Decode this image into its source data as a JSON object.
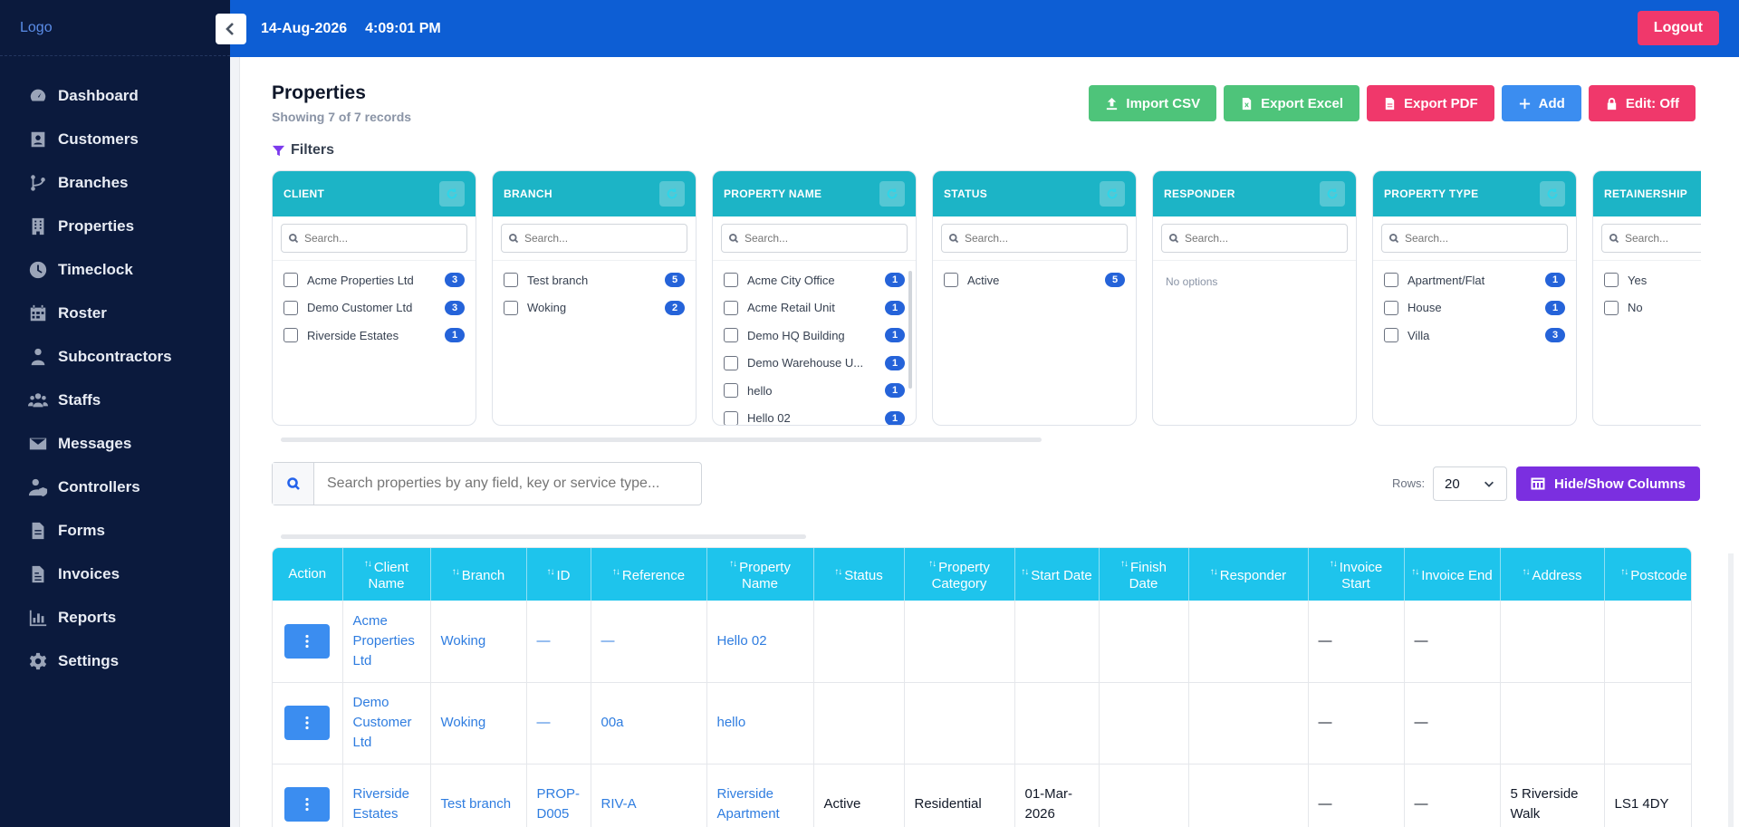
{
  "app": {
    "logo": "Logo"
  },
  "topbar": {
    "date": "14-Aug-2026",
    "time": "4:09:01 PM",
    "logout_label": "Logout"
  },
  "sidebar": {
    "items": [
      {
        "label": "Dashboard",
        "icon": "dashboard-icon"
      },
      {
        "label": "Customers",
        "icon": "customers-icon"
      },
      {
        "label": "Branches",
        "icon": "branches-icon"
      },
      {
        "label": "Properties",
        "icon": "properties-icon"
      },
      {
        "label": "Timeclock",
        "icon": "timeclock-icon"
      },
      {
        "label": "Roster",
        "icon": "roster-icon"
      },
      {
        "label": "Subcontractors",
        "icon": "subcontractors-icon"
      },
      {
        "label": "Staffs",
        "icon": "staffs-icon"
      },
      {
        "label": "Messages",
        "icon": "messages-icon"
      },
      {
        "label": "Controllers",
        "icon": "controllers-icon"
      },
      {
        "label": "Forms",
        "icon": "forms-icon"
      },
      {
        "label": "Invoices",
        "icon": "invoices-icon"
      },
      {
        "label": "Reports",
        "icon": "reports-icon"
      },
      {
        "label": "Settings",
        "icon": "settings-icon"
      }
    ]
  },
  "page": {
    "title": "Properties",
    "record_count": "Showing 7 of 7 records",
    "filters_label": "Filters"
  },
  "actions": {
    "import_csv": "Import CSV",
    "export_excel": "Export Excel",
    "export_pdf": "Export PDF",
    "add": "Add",
    "edit": "Edit: Off"
  },
  "colors": {
    "sidebar_bg": "#0b1a3d",
    "topbar_bg": "#0d5ed4",
    "filter_header": "#1cb4c6",
    "table_header": "#1ec4ec",
    "accent_green": "#4ec47a",
    "accent_pink": "#f0386b",
    "accent_blue": "#3b8df0",
    "accent_purple": "#7b2fe0"
  },
  "filters": [
    {
      "title": "CLIENT",
      "placeholder": "Search...",
      "options": [
        {
          "label": "Acme Properties Ltd",
          "count": "3"
        },
        {
          "label": "Demo Customer Ltd",
          "count": "3"
        },
        {
          "label": "Riverside Estates",
          "count": "1"
        }
      ]
    },
    {
      "title": "BRANCH",
      "placeholder": "Search...",
      "options": [
        {
          "label": "Test branch",
          "count": "5"
        },
        {
          "label": "Woking",
          "count": "2"
        }
      ]
    },
    {
      "title": "PROPERTY NAME",
      "placeholder": "Search...",
      "options": [
        {
          "label": "Acme City Office",
          "count": "1"
        },
        {
          "label": "Acme Retail Unit",
          "count": "1"
        },
        {
          "label": "Demo HQ Building",
          "count": "1"
        },
        {
          "label": "Demo Warehouse U...",
          "count": "1"
        },
        {
          "label": "hello",
          "count": "1"
        },
        {
          "label": "Hello 02",
          "count": "1"
        }
      ]
    },
    {
      "title": "STATUS",
      "placeholder": "Search...",
      "options": [
        {
          "label": "Active",
          "count": "5"
        }
      ]
    },
    {
      "title": "RESPONDER",
      "placeholder": "Search...",
      "options": [],
      "empty": "No options"
    },
    {
      "title": "PROPERTY TYPE",
      "placeholder": "Search...",
      "options": [
        {
          "label": "Apartment/Flat",
          "count": "1"
        },
        {
          "label": "House",
          "count": "1"
        },
        {
          "label": "Villa",
          "count": "3"
        }
      ]
    },
    {
      "title": "RETAINERSHIP",
      "placeholder": "Search...",
      "options": [
        {
          "label": "Yes",
          "count": ""
        },
        {
          "label": "No",
          "count": ""
        }
      ]
    }
  ],
  "search": {
    "placeholder": "Search properties by any field, key or service type..."
  },
  "rows": {
    "label": "Rows:",
    "value": "20"
  },
  "hide_show_label": "Hide/Show Columns",
  "table": {
    "columns": [
      {
        "label": "Action",
        "sortable": false
      },
      {
        "label": "Client Name",
        "sortable": true
      },
      {
        "label": "Branch",
        "sortable": true
      },
      {
        "label": "ID",
        "sortable": true
      },
      {
        "label": "Reference",
        "sortable": true
      },
      {
        "label": "Property Name",
        "sortable": true
      },
      {
        "label": "Status",
        "sortable": true
      },
      {
        "label": "Property Category",
        "sortable": true
      },
      {
        "label": "Start Date",
        "sortable": true
      },
      {
        "label": "Finish Date",
        "sortable": true
      },
      {
        "label": "Responder",
        "sortable": true
      },
      {
        "label": "Invoice Start",
        "sortable": true
      },
      {
        "label": "Invoice End",
        "sortable": true
      },
      {
        "label": "Address",
        "sortable": true
      },
      {
        "label": "Postcode",
        "sortable": true
      }
    ],
    "rows": [
      {
        "client": "Acme Properties Ltd",
        "branch": "Woking",
        "id": "—",
        "reference": "—",
        "property": "Hello 02",
        "status": "",
        "category": "",
        "start": "",
        "finish": "",
        "responder": "",
        "inv_start": "—",
        "inv_end": "—",
        "address": "",
        "postcode": ""
      },
      {
        "client": "Demo Customer Ltd",
        "branch": "Woking",
        "id": "—",
        "reference": "00a",
        "property": "hello",
        "status": "",
        "category": "",
        "start": "",
        "finish": "",
        "responder": "",
        "inv_start": "—",
        "inv_end": "—",
        "address": "",
        "postcode": ""
      },
      {
        "client": "Riverside Estates",
        "branch": "Test branch",
        "id": "PROP-D005",
        "reference": "RIV-A",
        "property": "Riverside Apartment",
        "status": "Active",
        "category": "Residential",
        "start": "01-Mar-2026",
        "finish": "",
        "responder": "",
        "inv_start": "—",
        "inv_end": "—",
        "address": "5 Riverside Walk",
        "postcode": "LS1 4DY"
      }
    ]
  }
}
